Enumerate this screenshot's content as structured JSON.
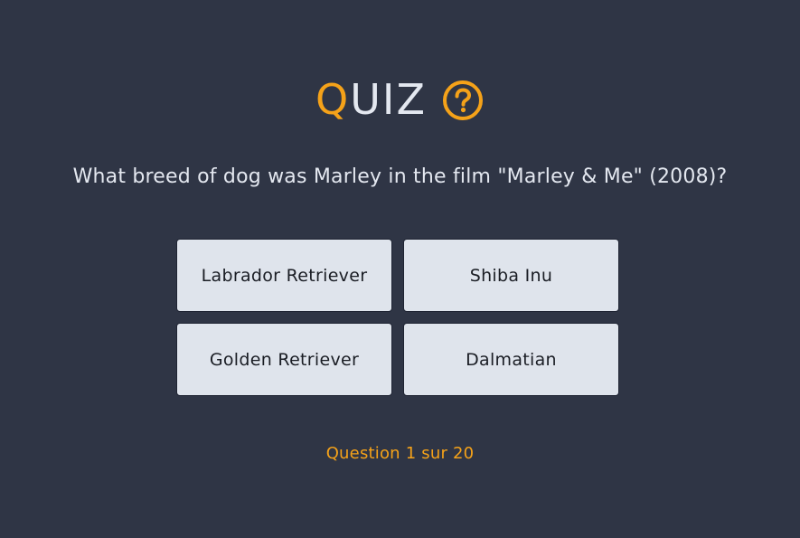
{
  "quiz": {
    "title_first_letter": "Q",
    "title_rest": "UIZ",
    "help_icon": "question-circle-icon",
    "accent_color": "#f5a219",
    "background_color": "#2f3545",
    "question": "What breed of dog was Marley in the film \"Marley & Me\" (2008)?",
    "answers": [
      "Labrador Retriever",
      "Shiba Inu",
      "Golden Retriever",
      "Dalmatian"
    ],
    "progress_text": "Question 1 sur 20"
  }
}
